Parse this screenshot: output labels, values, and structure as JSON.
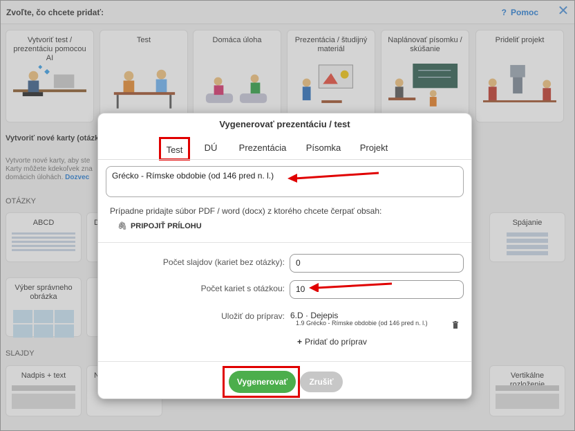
{
  "header": {
    "title": "Zvoľte, čo chcete pridať:",
    "help_label": "Pomoc",
    "help_glyph": "?",
    "close_glyph": "✕"
  },
  "top_cards": [
    {
      "label": "Vytvoriť test / prezentáciu pomocou AI"
    },
    {
      "label": "Test"
    },
    {
      "label": "Domáca úloha"
    },
    {
      "label": "Prezentácia / študijný materiál"
    },
    {
      "label": "Naplánovať písomku / skúšanie"
    },
    {
      "label": "Prideliť projekt"
    }
  ],
  "new_cards": {
    "title": "Vytvoriť nové karty (otázky",
    "desc_line1": "Vytvorte nové karty, aby ste",
    "desc_line2": "Karty môžete kdekoľvek zna",
    "desc_line3": "domácich úlohách.",
    "desc_link": "Dozvec"
  },
  "questions_section": {
    "title": "OTÁZKY",
    "cards": [
      "ABCD",
      "Do",
      "Spájanie",
      "Výber správneho obrázka"
    ]
  },
  "slides_section": {
    "title": "SLAJDY",
    "cards": [
      "Nadpis + text",
      "N",
      "Vertikálne rozloženie"
    ]
  },
  "modal": {
    "title": "Vygenerovať prezentáciu / test",
    "tabs": [
      "Test",
      "DÚ",
      "Prezentácia",
      "Písomka",
      "Projekt"
    ],
    "topic_value": "Grécko - Rímske obdobie (od 146 pred n. l.)",
    "pdf_note": "Prípadne pridajte súbor PDF / word (docx) z ktorého chcete čerpať obsah:",
    "attach_label": "PRIPOJIŤ PRÍLOHU",
    "slides_label": "Počet slajdov (kariet bez otázky):",
    "slides_value": "0",
    "question_cards_label": "Počet kariet s otázkou:",
    "question_cards_value": "10",
    "save_label": "Uložiť do príprav:",
    "save_value": "6.D · Dejepis",
    "save_sub": "1.9  Grécko - Rímske obdobie (od 146 pred n. l.)",
    "add_prep_label": "Pridať do príprav",
    "generate_label": "Vygenerovať",
    "cancel_label": "Zrušiť"
  },
  "colors": {
    "accent_blue": "#2a7fd4",
    "generate_green": "#4cae4c",
    "highlight_red": "#e00000"
  }
}
